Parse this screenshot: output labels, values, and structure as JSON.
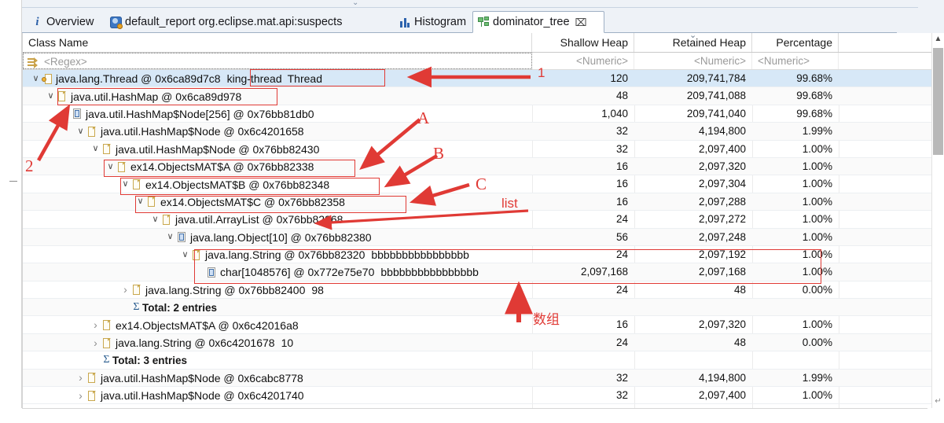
{
  "window": {
    "tabs": [
      {
        "label": "Overview",
        "icon": "info-icon",
        "active": false
      },
      {
        "label": "default_report org.eclipse.mat.api:suspects",
        "icon": "report-icon",
        "active": false
      },
      {
        "label": "Histogram",
        "icon": "histogram-icon",
        "active": false
      },
      {
        "label": "dominator_tree",
        "icon": "dominator-tree-icon",
        "active": true,
        "close": "⌧"
      }
    ]
  },
  "table": {
    "columns": [
      {
        "key": "class_name",
        "label": "Class Name",
        "align": "left"
      },
      {
        "key": "shallow_heap",
        "label": "Shallow Heap",
        "align": "right"
      },
      {
        "key": "retained_heap",
        "label": "Retained Heap",
        "align": "right"
      },
      {
        "key": "percentage",
        "label": "Percentage",
        "align": "right"
      }
    ],
    "filters": {
      "class_name": "<Regex>",
      "shallow_heap": "<Numeric>",
      "retained_heap": "<Numeric>",
      "percentage": "<Numeric>"
    },
    "rows": [
      {
        "indent": 0,
        "twisty": "open",
        "icon": "thread-object-icon",
        "name": "java.lang.Thread @ 0x6ca89d7c8",
        "value": "king-thread",
        "extra": "Thread",
        "shallow": "120",
        "retained": "209,741,784",
        "pct": "99.68%",
        "selected": true
      },
      {
        "indent": 1,
        "twisty": "open",
        "icon": "object-icon",
        "name": "java.util.HashMap @ 0x6ca89d978",
        "value": "",
        "extra": "",
        "shallow": "48",
        "retained": "209,741,088",
        "pct": "99.68%"
      },
      {
        "indent": 2,
        "twisty": "open",
        "icon": "array-object-icon",
        "name": "java.util.HashMap$Node[256] @ 0x76bb81db0",
        "value": "",
        "extra": "",
        "shallow": "1,040",
        "retained": "209,741,040",
        "pct": "99.68%"
      },
      {
        "indent": 3,
        "twisty": "open",
        "icon": "object-icon",
        "name": "java.util.HashMap$Node @ 0x6c4201658",
        "value": "",
        "extra": "",
        "shallow": "32",
        "retained": "4,194,800",
        "pct": "1.99%"
      },
      {
        "indent": 4,
        "twisty": "open",
        "icon": "object-icon",
        "name": "java.util.HashMap$Node @ 0x76bb82430",
        "value": "",
        "extra": "",
        "shallow": "32",
        "retained": "2,097,400",
        "pct": "1.00%"
      },
      {
        "indent": 5,
        "twisty": "open",
        "icon": "object-icon",
        "name": "ex14.ObjectsMAT$A @ 0x76bb82338",
        "value": "",
        "extra": "",
        "shallow": "16",
        "retained": "2,097,320",
        "pct": "1.00%"
      },
      {
        "indent": 6,
        "twisty": "open",
        "icon": "object-icon",
        "name": "ex14.ObjectsMAT$B @ 0x76bb82348",
        "value": "",
        "extra": "",
        "shallow": "16",
        "retained": "2,097,304",
        "pct": "1.00%"
      },
      {
        "indent": 7,
        "twisty": "open",
        "icon": "object-icon",
        "name": "ex14.ObjectsMAT$C @ 0x76bb82358",
        "value": "",
        "extra": "",
        "shallow": "16",
        "retained": "2,097,288",
        "pct": "1.00%"
      },
      {
        "indent": 8,
        "twisty": "open",
        "icon": "object-icon",
        "name": "java.util.ArrayList @ 0x76bb82368",
        "value": "",
        "extra": "",
        "shallow": "24",
        "retained": "2,097,272",
        "pct": "1.00%"
      },
      {
        "indent": 9,
        "twisty": "open",
        "icon": "array-object-icon",
        "name": "java.lang.Object[10] @ 0x76bb82380",
        "value": "",
        "extra": "",
        "shallow": "56",
        "retained": "2,097,248",
        "pct": "1.00%"
      },
      {
        "indent": 10,
        "twisty": "open",
        "icon": "object-icon",
        "name": "java.lang.String @ 0x76bb82320",
        "value": "bbbbbbbbbbbbbbbb",
        "extra": "",
        "shallow": "24",
        "retained": "2,097,192",
        "pct": "1.00%"
      },
      {
        "indent": 11,
        "twisty": "none",
        "icon": "array-object-icon",
        "name": "char[1048576] @ 0x772e75e70",
        "value": "bbbbbbbbbbbbbbbb",
        "extra": "",
        "shallow": "2,097,168",
        "retained": "2,097,168",
        "pct": "1.00%"
      },
      {
        "indent": 6,
        "twisty": "closed",
        "icon": "object-icon",
        "name": "java.lang.String @ 0x76bb82400",
        "value": "98",
        "extra": "",
        "shallow": "24",
        "retained": "48",
        "pct": "0.00%"
      },
      {
        "indent": 6,
        "twisty": "none",
        "icon": "sigma-icon",
        "name": "Total: 2 entries",
        "total": true,
        "value": "",
        "extra": "",
        "shallow": "",
        "retained": "",
        "pct": ""
      },
      {
        "indent": 4,
        "twisty": "closed",
        "icon": "object-icon",
        "name": "ex14.ObjectsMAT$A @ 0x6c42016a8",
        "value": "",
        "extra": "",
        "shallow": "16",
        "retained": "2,097,320",
        "pct": "1.00%"
      },
      {
        "indent": 4,
        "twisty": "closed",
        "icon": "object-icon",
        "name": "java.lang.String @ 0x6c4201678",
        "value": "10",
        "extra": "",
        "shallow": "24",
        "retained": "48",
        "pct": "0.00%"
      },
      {
        "indent": 4,
        "twisty": "none",
        "icon": "sigma-icon",
        "name": "Total: 3 entries",
        "total": true,
        "value": "",
        "extra": "",
        "shallow": "",
        "retained": "",
        "pct": ""
      },
      {
        "indent": 3,
        "twisty": "closed",
        "icon": "object-icon",
        "name": "java.util.HashMap$Node @ 0x6cabc8778",
        "value": "",
        "extra": "",
        "shallow": "32",
        "retained": "4,194,800",
        "pct": "1.99%"
      },
      {
        "indent": 3,
        "twisty": "closed",
        "icon": "object-icon",
        "name": "java.util.HashMap$Node @ 0x6c4201740",
        "value": "",
        "extra": "",
        "shallow": "32",
        "retained": "2,097,400",
        "pct": "1.00%"
      }
    ]
  },
  "annotations": {
    "color": "#e03a35",
    "labels": [
      {
        "id": "one",
        "text": "1"
      },
      {
        "id": "two",
        "text": "2"
      },
      {
        "id": "a",
        "text": "A"
      },
      {
        "id": "b",
        "text": "B"
      },
      {
        "id": "c",
        "text": "C"
      },
      {
        "id": "list",
        "text": "list"
      },
      {
        "id": "array",
        "text": "数组"
      }
    ]
  },
  "scrollbar": {
    "up": "▲",
    "down": "↵"
  }
}
